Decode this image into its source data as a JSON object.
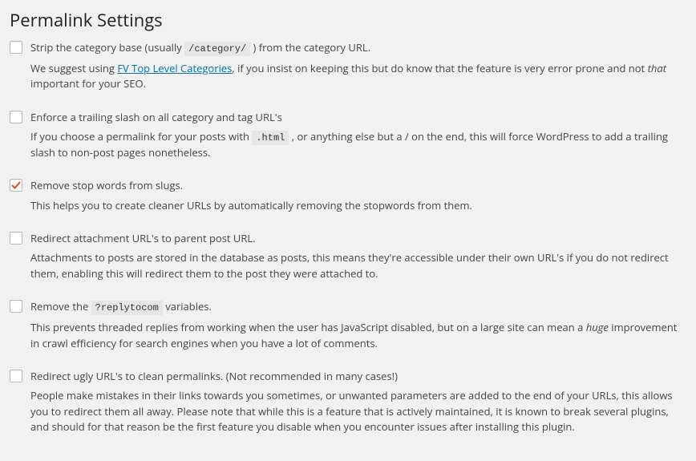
{
  "title": "Permalink Settings",
  "items": [
    {
      "checked": false,
      "label_pre": "Strip the category base (usually ",
      "label_code": "/category/",
      "label_post": " ) from the category URL.",
      "desc_pre": "We suggest using ",
      "desc_link": "FV Top Level Categories",
      "desc_mid": ", if you insist on keeping this but do know that the feature is very error prone and not ",
      "desc_em": "that",
      "desc_post": " important for your SEO."
    },
    {
      "checked": false,
      "label": "Enforce a trailing slash on all category and tag URL's",
      "desc_pre": "If you choose a permalink for your posts with ",
      "desc_code": ".html",
      "desc_post": " , or anything else but a / on the end, this will force WordPress to add a trailing slash to non-post pages nonetheless."
    },
    {
      "checked": true,
      "label": "Remove stop words from slugs.",
      "desc": "This helps you to create cleaner URLs by automatically removing the stopwords from them."
    },
    {
      "checked": false,
      "label": "Redirect attachment URL's to parent post URL.",
      "desc": "Attachments to posts are stored in the database as posts, this means they're accessible under their own URL's if you do not redirect them, enabling this will redirect them to the post they were attached to."
    },
    {
      "checked": false,
      "label_pre": "Remove the ",
      "label_code": "?replytocom",
      "label_post": " variables.",
      "desc_pre": "This prevents threaded replies from working when the user has JavaScript disabled, but on a large site can mean a ",
      "desc_em": "huge",
      "desc_post": " improvement in crawl efficiency for search engines when you have a lot of comments."
    },
    {
      "checked": false,
      "label": "Redirect ugly URL's to clean permalinks. (Not recommended in many cases!)",
      "desc": "People make mistakes in their links towards you sometimes, or unwanted parameters are added to the end of your URLs, this allows you to redirect them all away. Please note that while this is a feature that is actively maintained, it is known to break several plugins, and should for that reason be the first feature you disable when you encounter issues after installing this plugin."
    }
  ]
}
